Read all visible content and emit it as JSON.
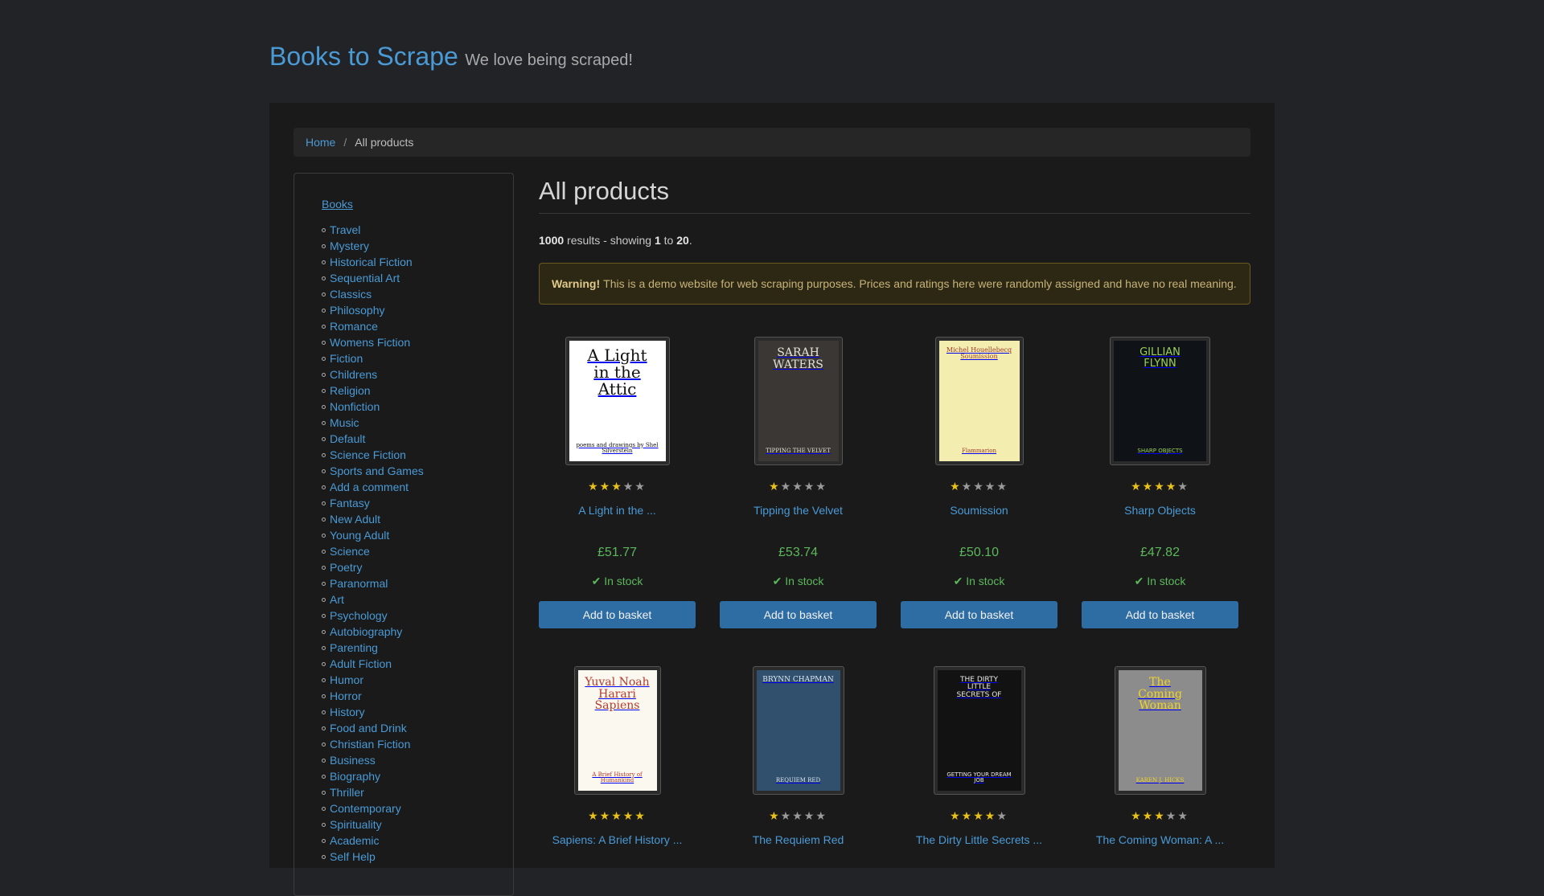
{
  "header": {
    "brand": "Books to Scrape",
    "tagline": "We love being scraped!"
  },
  "breadcrumb": {
    "home": "Home",
    "separator": "/",
    "current": "All products"
  },
  "sidebar": {
    "top": "Books",
    "categories": [
      "Travel",
      "Mystery",
      "Historical Fiction",
      "Sequential Art",
      "Classics",
      "Philosophy",
      "Romance",
      "Womens Fiction",
      "Fiction",
      "Childrens",
      "Religion",
      "Nonfiction",
      "Music",
      "Default",
      "Science Fiction",
      "Sports and Games",
      "Add a comment",
      "Fantasy",
      "New Adult",
      "Young Adult",
      "Science",
      "Poetry",
      "Paranormal",
      "Art",
      "Psychology",
      "Autobiography",
      "Parenting",
      "Adult Fiction",
      "Humor",
      "Horror",
      "History",
      "Food and Drink",
      "Christian Fiction",
      "Business",
      "Biography",
      "Thriller",
      "Contemporary",
      "Spirituality",
      "Academic",
      "Self Help"
    ]
  },
  "main": {
    "title": "All products",
    "results": {
      "count": "1000",
      "text1": " results - showing ",
      "from": "1",
      "to_word": " to ",
      "to": "20",
      "end": "."
    },
    "warning": {
      "strong": "Warning!",
      "text": "This is a demo website for web scraping purposes. Prices and ratings here were randomly assigned and have no real meaning."
    }
  },
  "products": [
    {
      "title": "A Light in the ...",
      "rating": 3,
      "price": "£51.77",
      "stock": "In stock",
      "button": "Add to basket",
      "cover_lines": [
        "A Light",
        "in the",
        "Attic"
      ],
      "cover_sub": "poems and drawings by Shel Silverstein"
    },
    {
      "title": "Tipping the Velvet",
      "rating": 1,
      "price": "£53.74",
      "stock": "In stock",
      "button": "Add to basket",
      "cover_lines": [
        "SARAH",
        "WATERS"
      ],
      "cover_sub": "TIPPING THE VELVET"
    },
    {
      "title": "Soumission",
      "rating": 1,
      "price": "£50.10",
      "stock": "In stock",
      "button": "Add to basket",
      "cover_lines": [
        "Michel Houellebecq",
        "Soumission"
      ],
      "cover_sub": "Flammarion"
    },
    {
      "title": "Sharp Objects",
      "rating": 4,
      "price": "£47.82",
      "stock": "In stock",
      "button": "Add to basket",
      "cover_lines": [
        "GILLIAN",
        "FLYNN"
      ],
      "cover_sub": "SHARP OBJECTS"
    },
    {
      "title": "Sapiens: A Brief History ...",
      "rating": 5,
      "cover_lines": [
        "Yuval Noah",
        "Harari",
        "Sapiens"
      ],
      "cover_sub": "A Brief History of Humankind"
    },
    {
      "title": "The Requiem Red",
      "rating": 1,
      "cover_lines": [
        "BRYNN CHAPMAN"
      ],
      "cover_sub": "REQUIEM RED"
    },
    {
      "title": "The Dirty Little Secrets ...",
      "rating": 4,
      "cover_lines": [
        "THE DIRTY",
        "LITTLE",
        "SECRETS OF"
      ],
      "cover_sub": "GETTING YOUR DREAM JOB"
    },
    {
      "title": "The Coming Woman: A ...",
      "rating": 3,
      "cover_lines": [
        "The",
        "Coming",
        "Woman"
      ],
      "cover_sub": "KAREN J. HICKS"
    }
  ],
  "colors": {
    "accent": "#4a9ad6",
    "price": "#5cb85c",
    "star": "#e8c11a",
    "button": "#2e6da4"
  }
}
